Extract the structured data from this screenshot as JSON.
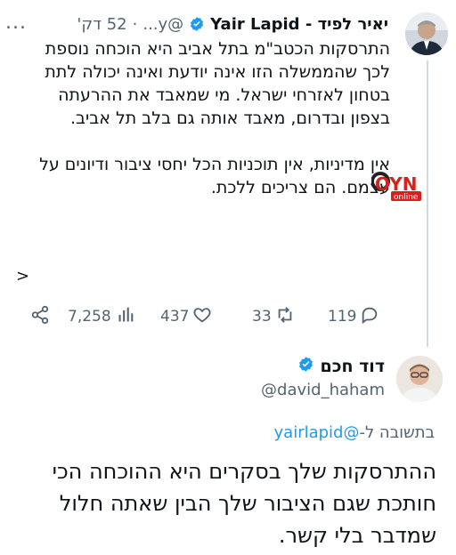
{
  "tweet": {
    "author_name": "יאיר לפיד - Yair Lapid",
    "handle": "@y...",
    "dot": "·",
    "time": "52 דק'",
    "more": "...",
    "paragraphs": [
      "התרסקות הכטב\"מ בתל אביב היא הוכחה נוספת לכך שהממשלה הזו אינה יודעת ואינה יכולה לתת בטחון לאזרחי ישראל. מי שמאבד את ההרעתה בצפון ובדרום, מאבד אותה גם בלב תל אביב.",
      "אין מדיניות, אין תוכניות הכל יחסי ציבור ודיונים על עצמם. הם צריכים ללכת."
    ],
    "show_more": ">",
    "stats": {
      "views": "7,258",
      "likes": "437",
      "retweets": "33",
      "replies": "119"
    }
  },
  "overlay_logo": {
    "text_main": "OYN",
    "text_sub": "online"
  },
  "reply": {
    "author_name": "דוד חכם",
    "handle": "@david_haham",
    "replying_prefix": "בתשובה ל-",
    "replying_to": "@yairlapid",
    "body": "ההתרסקות שלך בסקרים היא ההוכחה הכי\nחותכת שגם הציבור שלך הבין שאתה חלול\nשמדבר בלי קשר."
  },
  "colors": {
    "verified": "#1d9bf0",
    "muted": "#536471",
    "link": "#1d9bf0",
    "logo_red": "#d9211c"
  },
  "icons": [
    "verified-badge-icon",
    "more-icon",
    "reply-icon",
    "retweet-icon",
    "like-icon",
    "views-icon",
    "share-icon"
  ]
}
